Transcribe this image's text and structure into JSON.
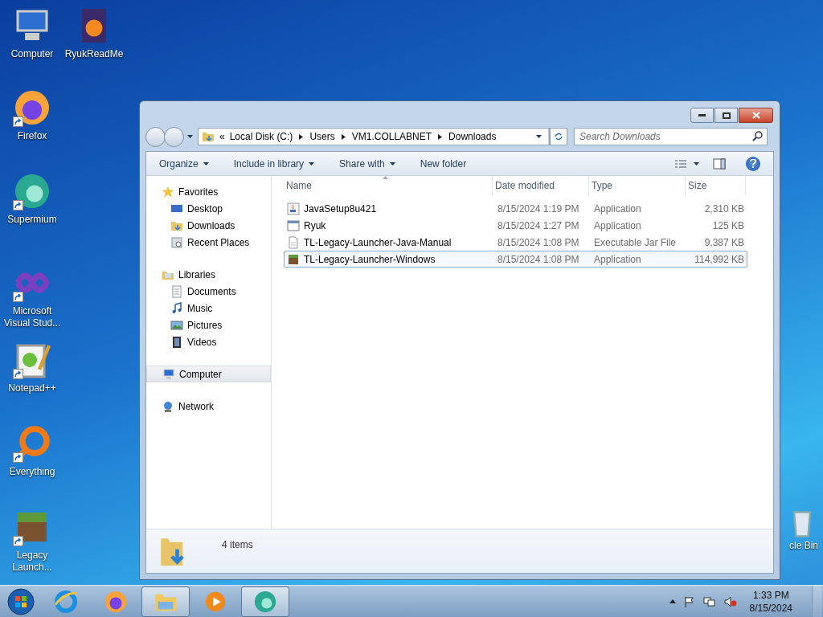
{
  "desktop_icons": [
    {
      "label": "Computer",
      "kind": "computer",
      "shortcut": false
    },
    {
      "label": "RyukReadMe",
      "kind": "doc",
      "shortcut": false
    },
    {
      "label": "Firefox",
      "kind": "firefox",
      "shortcut": true
    },
    {
      "label": "Supermium",
      "kind": "supermium",
      "shortcut": true
    },
    {
      "label": "Microsoft Visual Stud...",
      "kind": "vs",
      "shortcut": true
    },
    {
      "label": "Notepad++",
      "kind": "notepad",
      "shortcut": true
    },
    {
      "label": "Everything",
      "kind": "everything",
      "shortcut": true
    },
    {
      "label": "Legacy Launch...",
      "kind": "block",
      "shortcut": true
    },
    {
      "label": "cle Bin",
      "kind": "bin"
    }
  ],
  "window": {
    "address": {
      "overflow": "«",
      "segments": [
        "Local Disk (C:)",
        "Users",
        "VM1.COLLABNET",
        "Downloads"
      ]
    },
    "search": {
      "placeholder": "Search Downloads"
    },
    "toolbar": [
      {
        "label": "Organize",
        "dropdown": true
      },
      {
        "label": "Include in library",
        "dropdown": true
      },
      {
        "label": "Share with",
        "dropdown": true
      },
      {
        "label": "New folder",
        "dropdown": false
      }
    ],
    "nav": [
      {
        "label": "Favorites",
        "kind": "star",
        "selected": false,
        "children": [
          {
            "label": "Desktop",
            "kind": "desktop",
            "selected": false
          },
          {
            "label": "Downloads",
            "kind": "downloads",
            "selected": false
          },
          {
            "label": "Recent Places",
            "kind": "recent",
            "selected": false
          }
        ]
      },
      {
        "label": "Libraries",
        "kind": "library",
        "selected": false,
        "children": [
          {
            "label": "Documents",
            "kind": "documents",
            "selected": false
          },
          {
            "label": "Music",
            "kind": "music",
            "selected": false
          },
          {
            "label": "Pictures",
            "kind": "pictures",
            "selected": false
          },
          {
            "label": "Videos",
            "kind": "videos",
            "selected": false
          }
        ]
      },
      {
        "label": "Computer",
        "kind": "computer",
        "selected": true
      },
      {
        "label": "Network",
        "kind": "network",
        "selected": false
      }
    ],
    "columns": [
      "Name",
      "Date modified",
      "Type",
      "Size"
    ],
    "files": [
      {
        "name": "JavaSetup8u421",
        "date": "8/15/2024 1:19 PM",
        "type": "Application",
        "size": "2,310 KB",
        "kind": "java",
        "selected": false
      },
      {
        "name": "Ryuk",
        "date": "8/15/2024 1:27 PM",
        "type": "Application",
        "size": "125 KB",
        "kind": "app",
        "selected": false
      },
      {
        "name": "TL-Legacy-Launcher-Java-Manual",
        "date": "8/15/2024 1:08 PM",
        "type": "Executable Jar File",
        "size": "9,387 KB",
        "kind": "jar",
        "selected": false
      },
      {
        "name": "TL-Legacy-Launcher-Windows",
        "date": "8/15/2024 1:08 PM",
        "type": "Application",
        "size": "114,992 KB",
        "kind": "block",
        "selected": true
      }
    ],
    "status": "4 items"
  },
  "taskbar": {
    "items": [
      {
        "kind": "ie",
        "active": false
      },
      {
        "kind": "firefox",
        "active": false
      },
      {
        "kind": "explorer",
        "active": true
      },
      {
        "kind": "media",
        "active": false
      },
      {
        "kind": "supermium",
        "active": true
      }
    ],
    "time": "1:33 PM",
    "date": "8/15/2024"
  }
}
